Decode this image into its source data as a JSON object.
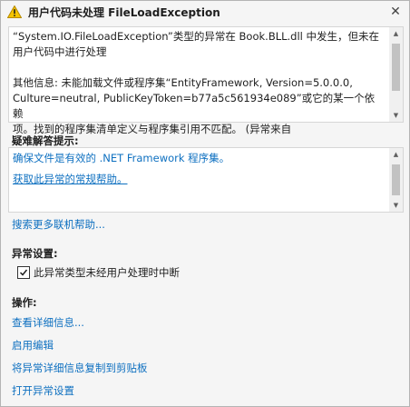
{
  "dialog": {
    "title": "用户代码未处理 FileLoadException",
    "close_symbol": "✕"
  },
  "message": {
    "line1": "“System.IO.FileLoadException”类型的异常在 Book.BLL.dll 中发生，但未在",
    "line2": "用户代码中进行处理",
    "line3": "其他信息: 未能加载文件或程序集“EntityFramework, Version=5.0.0.0,",
    "line4": "Culture=neutral, PublicKeyToken=b77a5c561934e089”或它的某一个依赖",
    "line5": "项。找到的程序集清单定义与程序集引用不匹配。 (异常来自"
  },
  "tips": {
    "heading": "疑难解答提示:",
    "items": [
      "确保文件是有效的 .NET Framework 程序集。",
      "获取此异常的常规帮助。"
    ],
    "search_more": "搜索更多联机帮助..."
  },
  "settings": {
    "heading": "异常设置:",
    "break_checkbox_label": "此异常类型未经用户处理时中断",
    "break_checked": true
  },
  "actions": {
    "heading": "操作:",
    "items": [
      "查看详细信息...",
      "启用编辑",
      "将异常详细信息复制到剪贴板",
      "打开异常设置"
    ]
  },
  "icons": {
    "warning": "warning-icon",
    "close": "close-icon",
    "check": "checkmark-icon"
  },
  "colors": {
    "link": "#0e70c0",
    "warning_fill": "#f5c400"
  }
}
